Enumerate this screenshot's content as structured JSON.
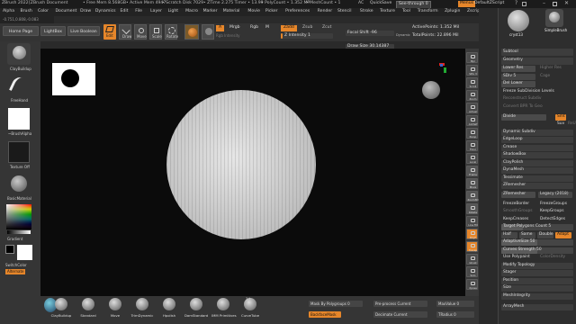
{
  "titlebar": {
    "app": "ZBrush 2022",
    "doc": "[ZBrush Document",
    "free_mem": "• Free Mem 8.568GB",
    "active_mem": "• Active Mem 4947",
    "scratch": "• Scratch Disk 7029",
    "ztime": "• ZTime 2.275 Timer • 13.99",
    "polycount": "• PolyCount • 1.352 MP",
    "meshcount": "• MeshCount • 1",
    "ac": "AC",
    "quicksave": "QuickSave",
    "seethrough": "See-through  0",
    "menus": "Menus",
    "script": "DefaultZScript"
  },
  "menubar": [
    "Alpha",
    "Brush",
    "Color",
    "Document",
    "Draw",
    "Dynamics",
    "Edit",
    "File",
    "Layer",
    "Light",
    "Macro",
    "Marker",
    "Material",
    "Movie",
    "Picker",
    "Preferences",
    "Render",
    "Stencil",
    "Stroke",
    "Texture",
    "Tool",
    "Transform",
    "Zplugin",
    "Zscript",
    "Help"
  ],
  "coords": "-0.751,0.808,-0.083",
  "shelf": {
    "home": "Home Page",
    "lightbox": "LightBox",
    "livebool": "Live Boolean",
    "edit": "Edit",
    "draw": "Draw",
    "move": "Move",
    "scale": "Scale",
    "rotate": "Rotate",
    "a": "A",
    "mrgb": "Mrgb",
    "rgb": "Rgb",
    "m": "M",
    "rgb_intensity": "Rgb Intensity",
    "zadd": "Zadd",
    "zsub": "Zsub",
    "zcut": "Zcut",
    "z_intensity": "Z Intensity  1",
    "focal_shift": "Focal Shift  -96",
    "draw_size": "Draw Size  30.14387",
    "dynamic": "Dynamic",
    "active_points": "ActivePoints: 1.352 Mil",
    "total_points": "TotalPoints: 22.896 Mil"
  },
  "leftpanel": {
    "brush": "ClayBuildup",
    "stroke": "FreeHand",
    "alpha": "~BrushAlpha",
    "texture": "Texture Off",
    "material": "BasicMaterial",
    "gradient": "Gradient",
    "switch": "SwitchColor",
    "alternate": "Alternate"
  },
  "bottom": {
    "brushes": [
      "ClayBuildup",
      "Standard",
      "Move",
      "TrimDynamic",
      "Hpolish",
      "DamStandard",
      "IMM Primitives",
      "CurveTube"
    ],
    "imm_count": "14",
    "mask_by_poly": "Mask By Polygroups  0",
    "backface": "BackfaceMask",
    "preprocess": "Pre-process Current",
    "decimate": "Decimate Current",
    "maxvalue": "MaxValue  0",
    "tradius": "TRadius  0"
  },
  "rightshelf": [
    "Bpr",
    "SPix 3",
    "Scroll",
    "Zoom",
    "Actual",
    "AAHalf",
    "Persp",
    "Floor",
    "Local",
    "Frame",
    "Move",
    "Zoom3D",
    "Rotate",
    "Line Fill",
    "PolyF",
    "Transp",
    "Ghost",
    "Solo",
    "Xpose"
  ],
  "tool": {
    "thumb1_label": "cryst13",
    "thumb2_label": "SimpleBrush",
    "subtool": "Subtool",
    "geometry": "Geometry",
    "lower_res": "Lower Res",
    "higher_res": "Higher Res",
    "sdiv": "SDiv  5",
    "cage": "Cage",
    "rstr": "Rstr",
    "del_lower": "Del Lower",
    "del_higher": "Del Higher",
    "freeze_sub": "Freeze SubDivision Levels",
    "reconstruct": "Reconstruct Subdiv",
    "convert_bpr": "Convert BPR To Geo",
    "divide": "Divide",
    "smt": "Smt",
    "suv": "Suv",
    "rsmt": "ReUV",
    "dynamic_subdiv": "Dynamic Subdiv",
    "edgeloop": "EdgeLoop",
    "crease": "Crease",
    "shadowbox": "ShadowBox",
    "claypolish": "ClayPolish",
    "dynamesh": "DynaMesh",
    "tessimate": "Tessimate",
    "zremesher": "ZRemesher",
    "zremesher_btn": "ZRemesher",
    "legacy": "Legacy (2018)",
    "freeze_border": "FreezeBorder",
    "freeze_groups": "FreezeGroups",
    "smooth_groups": "SmoothGroups",
    "keep_groups": "KeepGroups",
    "keep_creases": "KeepCreases",
    "detect_edges": "DetectEdges",
    "target_poly": "Target Polygons Count  5",
    "half": "Half",
    "same": "Same",
    "double": "Double",
    "adapt": "Adapt",
    "adaptive_size": "AdaptiveSize  50",
    "curves_strength": "Curves Strength  50",
    "use_polypaint": "Use Polypaint",
    "color_density": "ColorDensity",
    "modify_topology": "Modify Topology",
    "stager": "Stager",
    "position": "Position",
    "size": "Size",
    "meshintegrity": "MeshIntegrity",
    "arraymesh": "ArrayMesh"
  },
  "colors": {
    "accent": "#e6862a",
    "panel": "#2e2e2e",
    "canvas": "#0b0b0b"
  }
}
